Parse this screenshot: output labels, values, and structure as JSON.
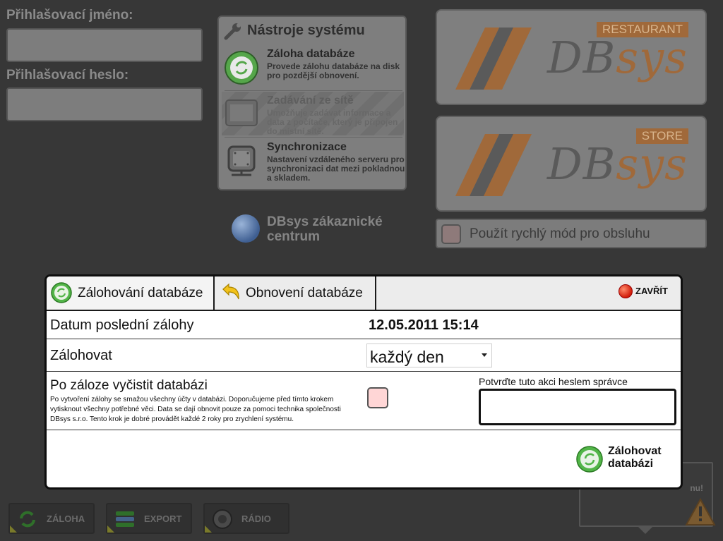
{
  "login": {
    "username_label": "Přihlašovací jméno:",
    "password_label": "Přihlašovací heslo:",
    "username_value": "",
    "password_value": ""
  },
  "tools": {
    "title": "Nástroje systému",
    "items": [
      {
        "name": "Záloha databáze",
        "desc": "Provede zálohu databáze na disk pro pozdější obnovení.",
        "icon": "database-backup-icon",
        "enabled": true
      },
      {
        "name": "Zadávání ze sítě",
        "desc": "Umožňuje zadávat informace a data z počítače, který je připojen do místní sítě.",
        "icon": "network-input-icon",
        "enabled": false
      },
      {
        "name": "Synchronizace",
        "desc": "Nastavení vzdáleného serveru pro synchronizaci dat mezi pokladnou a skladem.",
        "icon": "sync-server-icon",
        "enabled": true
      }
    ]
  },
  "customer_center": {
    "label": "DBsys zákaznické centrum",
    "icon": "globe-icon"
  },
  "brands": [
    {
      "tag": "RESTAURANT",
      "logo_main": "DB",
      "logo_sys": "sys"
    },
    {
      "tag": "STORE",
      "logo_main": "DB",
      "logo_sys": "sys"
    }
  ],
  "fast_mode": {
    "label": "Použít rychlý mód pro obsluhu",
    "checked": false
  },
  "bottom_buttons": [
    {
      "label": "ZÁLOHA",
      "icon": "recycle-icon"
    },
    {
      "label": "EXPORT",
      "icon": "export-icon"
    },
    {
      "label": "RÁDIO",
      "icon": "radio-icon"
    }
  ],
  "warning": {
    "text": "nu!",
    "icon": "warning-icon"
  },
  "dialog": {
    "tabs": [
      {
        "label": "Zálohování databáze",
        "icon": "recycle-icon"
      },
      {
        "label": "Obnovení databáze",
        "icon": "undo-arrow-icon"
      }
    ],
    "close_label": "ZAVŘÍT",
    "last_backup_label": "Datum poslední zálohy",
    "last_backup_value": "12.05.2011 15:14",
    "frequency_label": "Zálohovat",
    "frequency_value": "každý den",
    "clean_title": "Po záloze vyčistit databázi",
    "clean_desc": "Po vytvoření zálohy se smažou všechny účty v databázi. Doporučujeme před tímto krokem vytisknout všechny potřebné věci. Data se dají obnovit pouze za pomoci technika společnosti DBsys s.r.o. Tento krok je dobré provádět každé 2 roky pro zrychlení systému.",
    "clean_checked": false,
    "password_label": "Potvrďte tuto akci heslem správce",
    "password_value": "",
    "backup_button_line1": "Zálohovat",
    "backup_button_line2": "databázi"
  }
}
